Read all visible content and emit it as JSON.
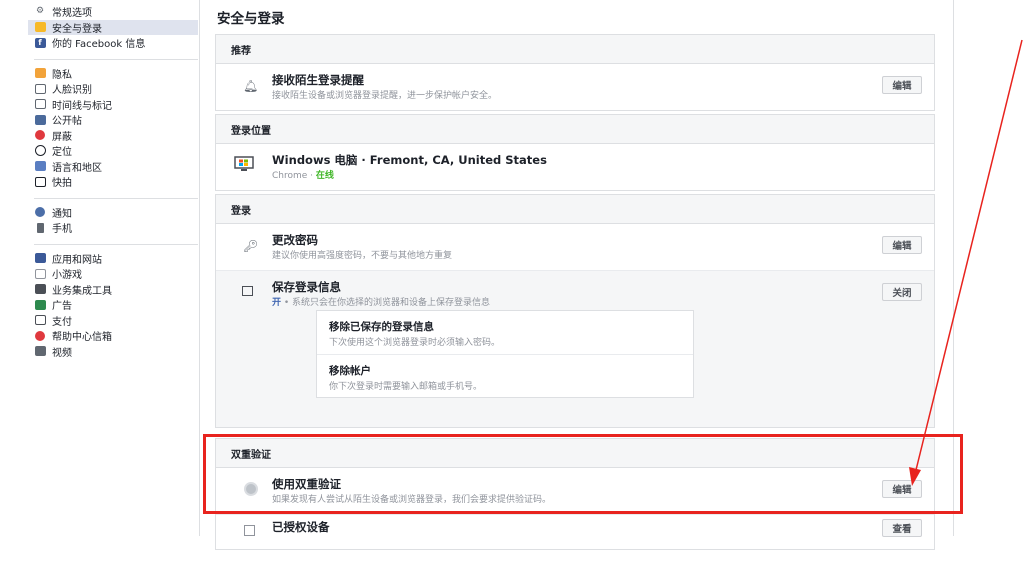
{
  "sidebar": {
    "groups": [
      [
        {
          "label": "常规选项",
          "icon": "gears-icon"
        },
        {
          "label": "安全与登录",
          "icon": "shield-icon",
          "active": true
        },
        {
          "label": "你的 Facebook 信息",
          "icon": "facebook-icon"
        }
      ],
      [
        {
          "label": "隐私",
          "icon": "lock-icon"
        },
        {
          "label": "人脸识别",
          "icon": "face-icon"
        },
        {
          "label": "时间线与标记",
          "icon": "timeline-icon"
        },
        {
          "label": "公开帖",
          "icon": "public-post-icon"
        },
        {
          "label": "屏蔽",
          "icon": "block-icon"
        },
        {
          "label": "定位",
          "icon": "location-icon"
        },
        {
          "label": "语言和地区",
          "icon": "language-icon"
        },
        {
          "label": "快拍",
          "icon": "stories-icon"
        }
      ],
      [
        {
          "label": "通知",
          "icon": "globe-icon"
        },
        {
          "label": "手机",
          "icon": "phone-icon"
        }
      ],
      [
        {
          "label": "应用和网站",
          "icon": "apps-icon"
        },
        {
          "label": "小游戏",
          "icon": "games-icon"
        },
        {
          "label": "业务集成工具",
          "icon": "business-icon"
        },
        {
          "label": "广告",
          "icon": "ads-icon"
        },
        {
          "label": "支付",
          "icon": "payment-icon"
        },
        {
          "label": "帮助中心信箱",
          "icon": "help-icon"
        },
        {
          "label": "视频",
          "icon": "video-icon"
        }
      ]
    ]
  },
  "main": {
    "title": "安全与登录",
    "recommended": {
      "header": "推荐",
      "title": "接收陌生登录提醒",
      "desc": "接收陌生设备或浏览器登录提醒，进一步保护帐户安全。",
      "button": "编辑"
    },
    "where_logged_in": {
      "header": "登录位置",
      "device": "Windows 电脑 · Fremont, CA, United States",
      "browser": "Chrome · ",
      "status": "在线"
    },
    "login": {
      "header": "登录",
      "change_password": {
        "title": "更改密码",
        "desc": "建议你使用高强度密码，不要与其他地方重复",
        "button": "编辑"
      },
      "save_login": {
        "title": "保存登录信息",
        "state": "开",
        "desc": " • 系统只会在你选择的浏览器和设备上保存登录信息",
        "button": "关闭"
      },
      "sub": [
        {
          "title": "移除已保存的登录信息",
          "desc": "下次使用这个浏览器登录时必须输入密码。"
        },
        {
          "title": "移除帐户",
          "desc": "你下次登录时需要输入邮箱或手机号。"
        }
      ]
    },
    "two_factor": {
      "header": "双重验证",
      "title": "使用双重验证",
      "desc": "如果发现有人尝试从陌生设备或浏览器登录，我们会要求提供验证码。",
      "button": "编辑"
    },
    "authorized": {
      "title": "已授权设备",
      "button": "查看"
    }
  },
  "annotation_color": "#e8231e"
}
